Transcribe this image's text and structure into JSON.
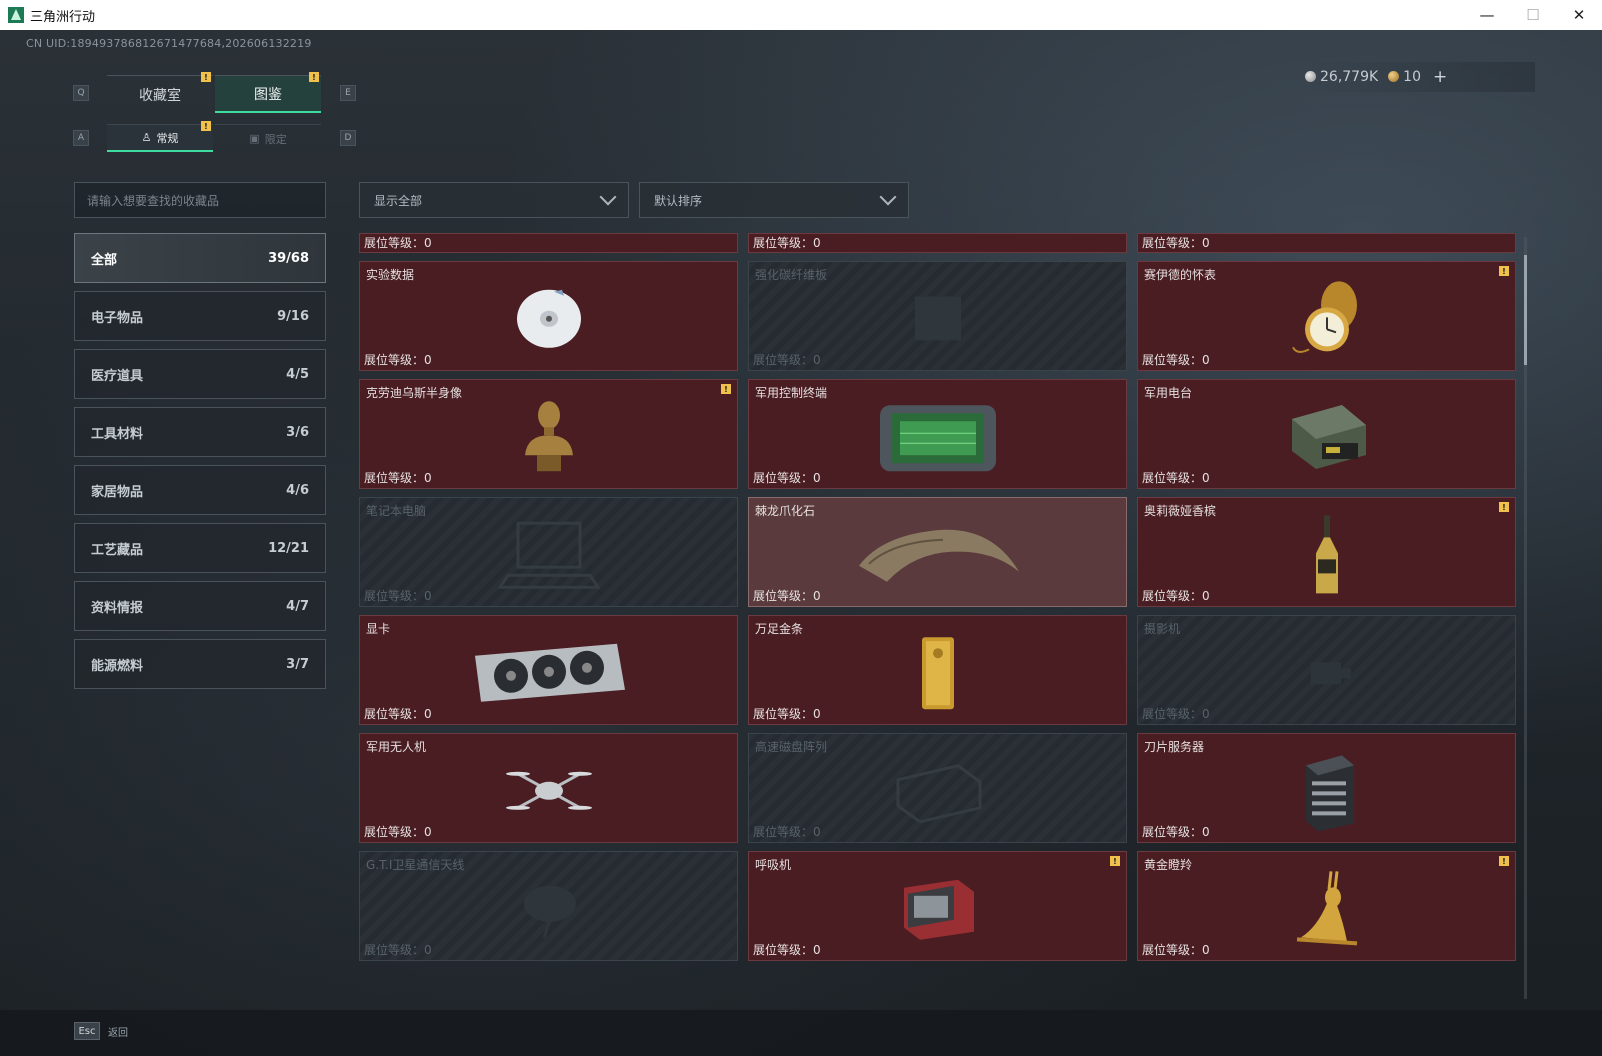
{
  "window": {
    "title": "三角洲行动",
    "minimize": "—",
    "maximize": "☐",
    "close": "✕"
  },
  "uid": "CN UID:189493786812671477684,202606132219",
  "currency": {
    "silver": "26,779K",
    "gold": "10",
    "plus": "+"
  },
  "keys": {
    "prev_tab": "Q",
    "next_tab": "E",
    "prev_sub": "A",
    "next_sub": "D",
    "esc": "Esc"
  },
  "tabs": [
    {
      "label": "收藏室",
      "badge": "!"
    },
    {
      "label": "图鉴",
      "badge": "!"
    }
  ],
  "subtabs": [
    {
      "label": "常规",
      "badge": "!"
    },
    {
      "label": "限定"
    }
  ],
  "search": {
    "placeholder": "请输入想要查找的收藏品"
  },
  "filters": {
    "show": "显示全部",
    "sort": "默认排序"
  },
  "categories": [
    {
      "label": "全部",
      "count": "39/68"
    },
    {
      "label": "电子物品",
      "count": "9/16"
    },
    {
      "label": "医疗道具",
      "count": "4/5"
    },
    {
      "label": "工具材料",
      "count": "3/6"
    },
    {
      "label": "家居物品",
      "count": "4/6"
    },
    {
      "label": "工艺藏品",
      "count": "12/21"
    },
    {
      "label": "资料情报",
      "count": "4/7"
    },
    {
      "label": "能源燃料",
      "count": "3/7"
    }
  ],
  "level_label": "展位等级：",
  "level_value": "0",
  "items": [
    {
      "name": "实验数据",
      "icon": "disc-icon"
    },
    {
      "name": "强化碳纤维板",
      "icon": "carbon-plate-icon"
    },
    {
      "name": "赛伊德的怀表",
      "icon": "pocket-watch-icon",
      "badge": "!"
    },
    {
      "name": "克劳迪乌斯半身像",
      "icon": "bust-icon",
      "badge": "!"
    },
    {
      "name": "军用控制终端",
      "icon": "control-terminal-icon"
    },
    {
      "name": "军用电台",
      "icon": "radio-icon"
    },
    {
      "name": "笔记本电脑",
      "icon": "laptop-icon"
    },
    {
      "name": "棘龙爪化石",
      "icon": "claw-fossil-icon"
    },
    {
      "name": "奥莉薇娅香槟",
      "icon": "champagne-icon",
      "badge": "!"
    },
    {
      "name": "显卡",
      "icon": "gpu-icon"
    },
    {
      "name": "万足金条",
      "icon": "gold-bar-icon"
    },
    {
      "name": "摄影机",
      "icon": "camera-icon"
    },
    {
      "name": "军用无人机",
      "icon": "drone-icon"
    },
    {
      "name": "高速磁盘阵列",
      "icon": "disk-array-icon"
    },
    {
      "name": "刀片服务器",
      "icon": "server-icon"
    },
    {
      "name": "G.T.I卫星通信天线",
      "icon": "satellite-dish-icon"
    },
    {
      "name": "呼吸机",
      "icon": "ventilator-icon",
      "badge": "!"
    },
    {
      "name": "黄金瞪羚",
      "icon": "gold-gazelle-icon",
      "badge": "!"
    }
  ],
  "back": "返回"
}
